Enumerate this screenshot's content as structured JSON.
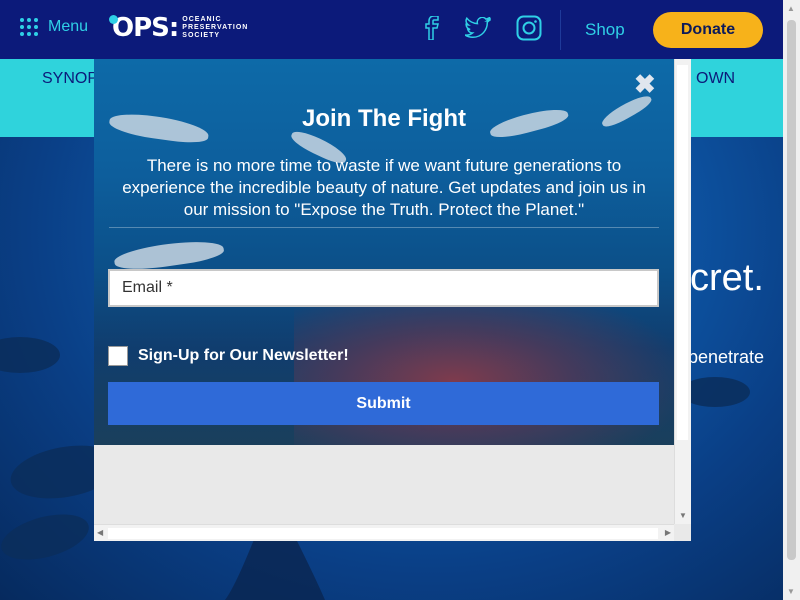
{
  "nav": {
    "menu_label": "Menu",
    "logo_mark": "OPS:",
    "logo_sub": "OCEANIC PRESERVATION SOCIETY",
    "social": [
      {
        "icon": "facebook-icon",
        "glyph": "f"
      },
      {
        "icon": "twitter-icon",
        "glyph": "t"
      },
      {
        "icon": "instagram-icon",
        "glyph": "◎"
      }
    ],
    "shop_label": "Shop",
    "donate_label": "Donate",
    "accent": "#2fd0e6",
    "donate_color": "#f7b21a",
    "nav_bg": "#0c1a7a"
  },
  "subnav": {
    "left_text": "SYNOP",
    "right_text": "R OWN",
    "bg": "#2fd3dc"
  },
  "hero": {
    "headline_fragment": "cret.",
    "body_fragment": "penetrate"
  },
  "modal": {
    "close_glyph": "✖",
    "title": "Join The Fight",
    "body": "There is no more time to waste if we want future generations to experience the incredible beauty of nature. Get updates and join us in our mission to \"Expose the Truth. Protect the Planet.\"",
    "email_placeholder": "Email *",
    "newsletter_label": "Sign-Up for Our Newsletter!",
    "submit_label": "Submit",
    "submit_color": "#2f6ad8"
  }
}
